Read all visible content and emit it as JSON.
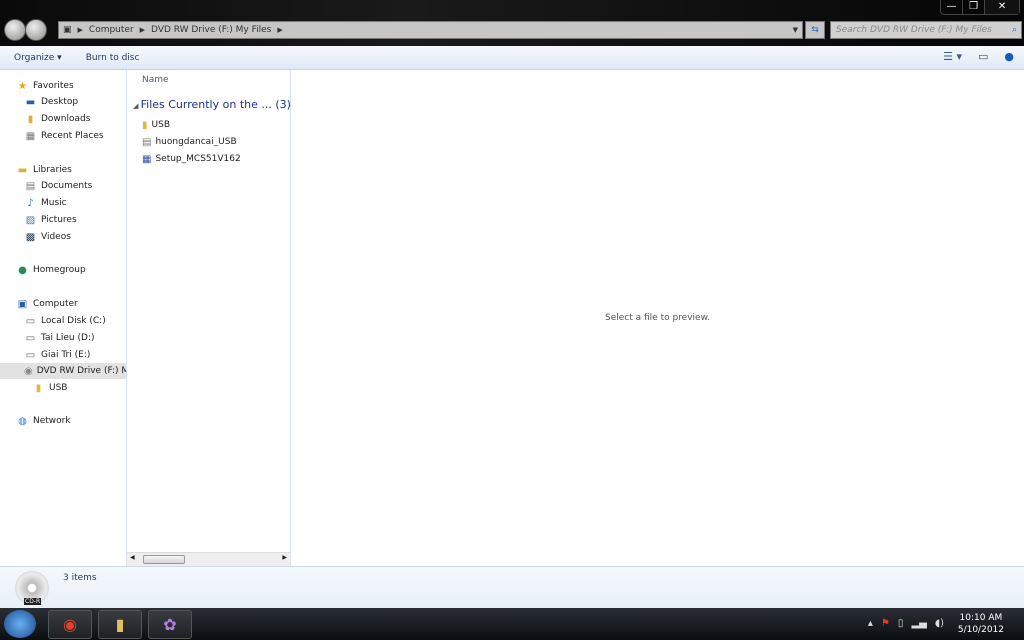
{
  "window": {
    "controls": [
      "—",
      "❐",
      "✕"
    ]
  },
  "address": {
    "crumbs": [
      "Computer",
      "DVD RW Drive (F:) My Files"
    ],
    "search_placeholder": "Search DVD RW Drive (F:) My Files"
  },
  "toolbar": {
    "organize": "Organize ▾",
    "burn": "Burn to disc"
  },
  "nav": {
    "items": [
      {
        "label": "Favorites",
        "icon": "star-icon",
        "glyph": "★",
        "color": "#f0a000"
      },
      {
        "label": "Desktop",
        "icon": "desktop-icon",
        "glyph": "▬",
        "color": "#2a5ca8"
      },
      {
        "label": "Downloads",
        "icon": "downloads-icon",
        "glyph": "▮",
        "color": "#d8b040"
      },
      {
        "label": "Recent Places",
        "icon": "recent-places-icon",
        "glyph": "▦",
        "color": "#777"
      },
      {
        "label": "Libraries",
        "icon": "libraries-icon",
        "glyph": "▬",
        "color": "#d8b040"
      },
      {
        "label": "Documents",
        "icon": "documents-icon",
        "glyph": "▤",
        "color": "#777"
      },
      {
        "label": "Music",
        "icon": "music-icon",
        "glyph": "♪",
        "color": "#2a7ad8"
      },
      {
        "label": "Pictures",
        "icon": "pictures-icon",
        "glyph": "▨",
        "color": "#4a7aa8"
      },
      {
        "label": "Videos",
        "icon": "videos-icon",
        "glyph": "▩",
        "color": "#345"
      },
      {
        "label": "Homegroup",
        "icon": "homegroup-icon",
        "glyph": "●",
        "color": "#2a8a5a"
      },
      {
        "label": "Computer",
        "icon": "computer-icon",
        "glyph": "▣",
        "color": "#2a5ca8"
      },
      {
        "label": "Local Disk (C:)",
        "icon": "drive-icon",
        "glyph": "▭",
        "color": "#666"
      },
      {
        "label": "Tai Lieu (D:)",
        "icon": "drive-icon",
        "glyph": "▭",
        "color": "#666"
      },
      {
        "label": "Giai Tri (E:)",
        "icon": "drive-icon",
        "glyph": "▭",
        "color": "#666"
      },
      {
        "label": "DVD RW Drive (F:) My Files",
        "icon": "dvd-drive-icon",
        "glyph": "◉",
        "color": "#888"
      },
      {
        "label": "USB",
        "icon": "folder-icon",
        "glyph": "▮",
        "color": "#e0b840"
      },
      {
        "label": "Network",
        "icon": "network-icon",
        "glyph": "◍",
        "color": "#2a7ad8"
      }
    ]
  },
  "files": {
    "column": "Name",
    "group": "Files Currently on the ... (3)",
    "items": [
      {
        "name": "USB",
        "icon": "folder-icon",
        "glyph": "▮",
        "color": "#e0b840"
      },
      {
        "name": "huongdancai_USB",
        "icon": "text-file-icon",
        "glyph": "▤",
        "color": "#777"
      },
      {
        "name": "Setup_MCS51V162",
        "icon": "setup-icon",
        "glyph": "▦",
        "color": "#3050a0"
      }
    ]
  },
  "preview": {
    "text": "Select a file to preview."
  },
  "details": {
    "count": "3 items",
    "drive_label": "CD-R"
  },
  "taskbar": {
    "time": "10:10 AM",
    "date": "5/10/2012"
  }
}
